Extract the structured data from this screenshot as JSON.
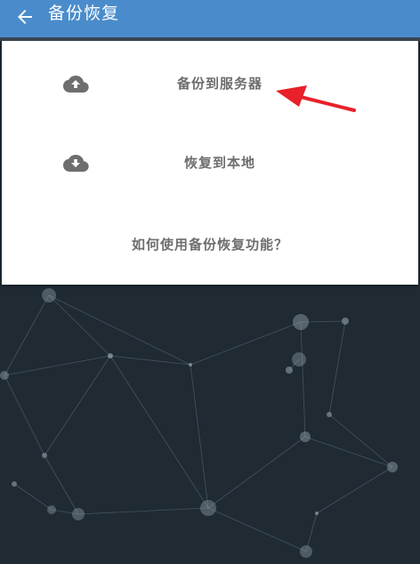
{
  "app_bar": {
    "title": "备份恢复",
    "back_icon": "arrow-left-icon",
    "color": "#4a8ccb"
  },
  "menu": {
    "items": [
      {
        "label": "备份到服务器",
        "icon": "cloud-upload-icon"
      },
      {
        "label": "恢复到本地",
        "icon": "cloud-download-icon"
      }
    ],
    "help_link": "如何使用备份恢复功能？"
  },
  "annotation": {
    "color": "#e8212b"
  },
  "background": {
    "color": "#1f2a33",
    "pattern": "network-graph"
  }
}
